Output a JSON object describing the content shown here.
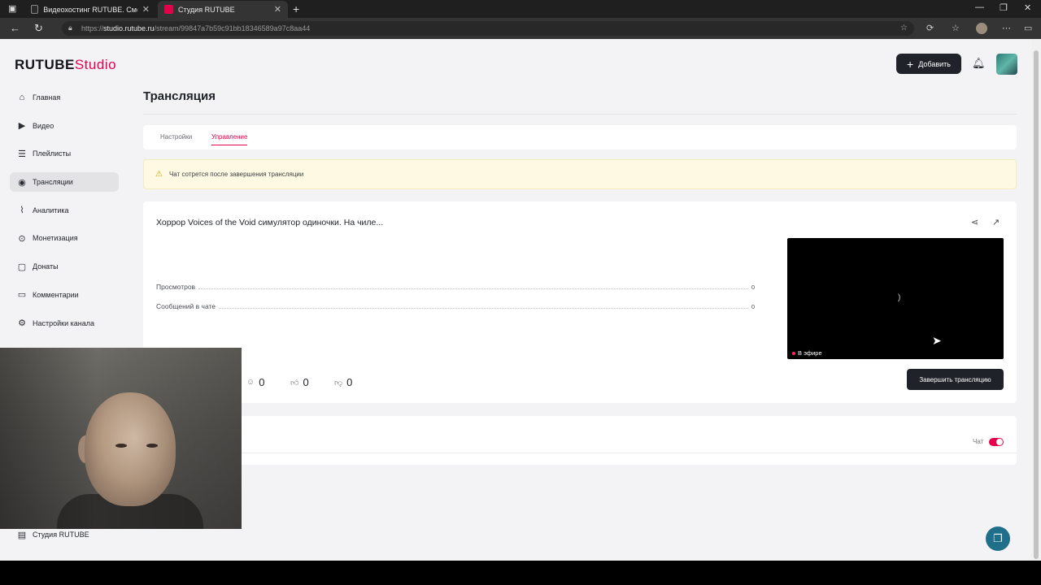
{
  "browser": {
    "tabs": [
      {
        "title": "Видеохостинг RUTUBE. Смотрите"
      },
      {
        "title": "Студия RUTUBE"
      }
    ],
    "url_host": "studio.rutube.ru",
    "url_path": "/stream/99847a7b59c91bb18346589a97c8aa44",
    "url_prefix": "https://"
  },
  "app": {
    "logo_main": "RUTUBE",
    "logo_accent": "Studio",
    "add_button": "Добавить"
  },
  "sidebar": {
    "items": [
      {
        "label": "Главная",
        "icon": "home-icon"
      },
      {
        "label": "Видео",
        "icon": "video-icon"
      },
      {
        "label": "Плейлисты",
        "icon": "playlist-icon"
      },
      {
        "label": "Трансляции",
        "icon": "broadcast-icon",
        "active": true
      },
      {
        "label": "Аналитика",
        "icon": "analytics-icon"
      },
      {
        "label": "Монетизация",
        "icon": "money-icon"
      },
      {
        "label": "Донаты",
        "icon": "gift-icon"
      },
      {
        "label": "Комментарии",
        "icon": "comment-icon"
      },
      {
        "label": "Настройки канала",
        "icon": "gear-icon"
      }
    ],
    "bottom_item": {
      "label": "Студия RUTUBE",
      "icon": "studio-icon"
    }
  },
  "page": {
    "title": "Трансляция",
    "tabs": [
      {
        "label": "Настройки"
      },
      {
        "label": "Управление",
        "active": true
      }
    ],
    "warning": "Чат сотрется после завершения трансляции"
  },
  "stream": {
    "title": "Хоррор Voices of the Void симулятор одиночки. На чиле...",
    "stats": [
      {
        "label": "Просмотров",
        "value": "0"
      },
      {
        "label": "Сообщений в чате",
        "value": "0"
      }
    ],
    "live_label": "В эфире",
    "reactions": {
      "viewers": "0",
      "likes": "0",
      "dislikes": "0"
    },
    "end_button": "Завершить трансляцию"
  },
  "chat": {
    "label": "Чат",
    "enabled": true
  },
  "colors": {
    "accent": "#e5004c",
    "dark": "#1f2228",
    "warning_bg": "#fdf9e3"
  }
}
